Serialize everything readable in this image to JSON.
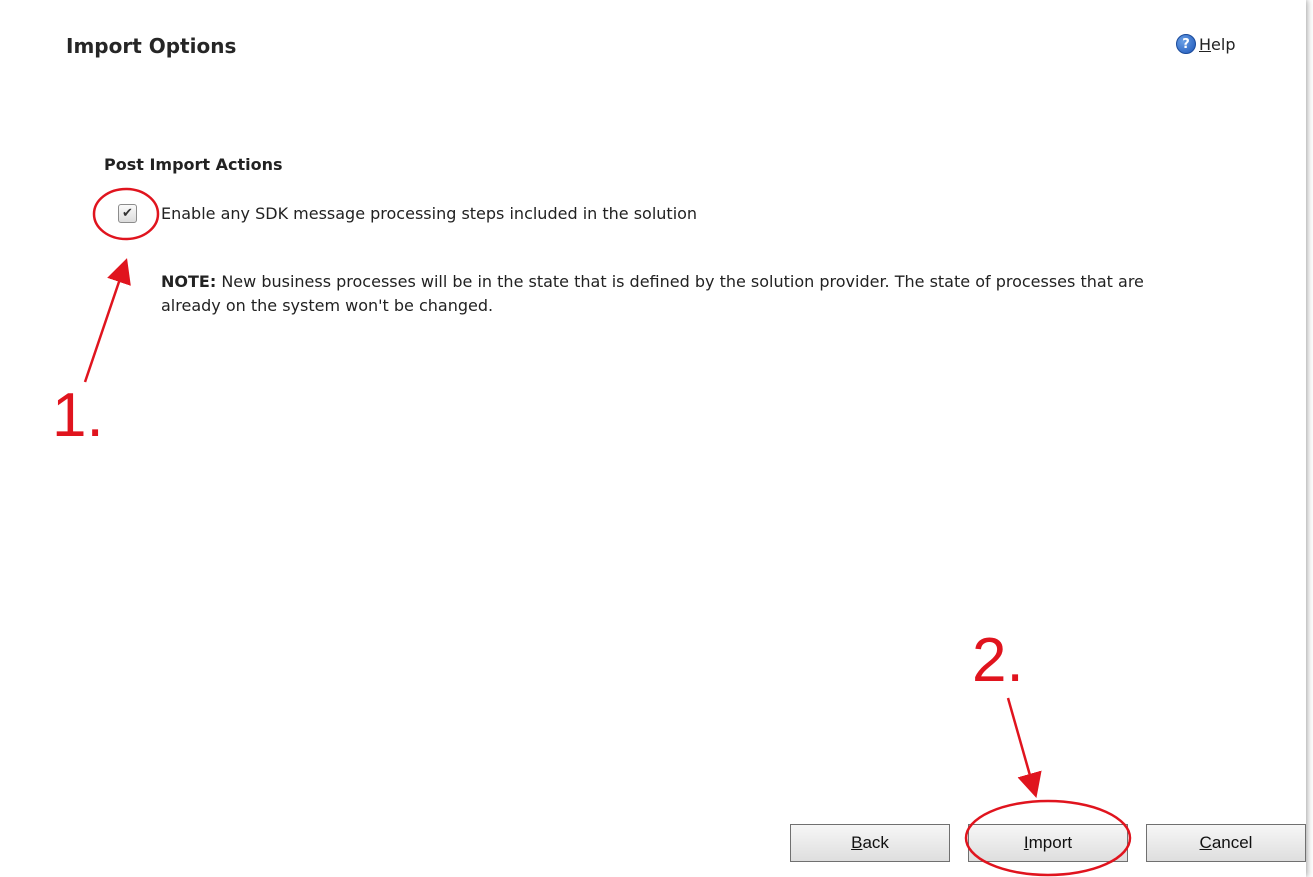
{
  "dialog": {
    "title": "Import Options",
    "help": {
      "icon": "question-icon",
      "hotkey": "H",
      "rest": "elp"
    }
  },
  "post_import": {
    "heading": "Post Import Actions",
    "checkbox": {
      "checked": true,
      "label": "Enable any SDK message processing steps included in the solution"
    },
    "note": {
      "prefix": "NOTE:",
      "text": "New business processes will be in the state that is defined by the solution provider. The state of processes that are already on the system won't be changed."
    }
  },
  "buttons": {
    "back": {
      "hotkey": "B",
      "rest": "ack"
    },
    "import": {
      "hotkey": "I",
      "rest": "mport"
    },
    "cancel": {
      "hotkey": "C",
      "rest": "ancel"
    }
  },
  "annotations": {
    "color": "#e0141e",
    "step1": "1.",
    "step2": "2."
  }
}
